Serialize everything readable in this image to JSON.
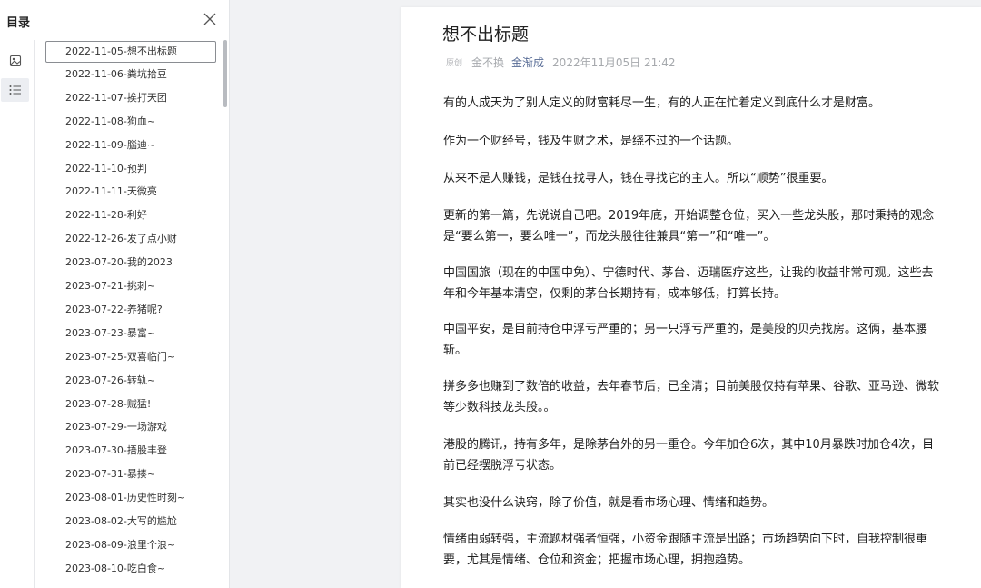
{
  "toc": {
    "title": "目录",
    "items": [
      "2022-11-05-想不出标题",
      "2022-11-06-粪坑拾豆",
      "2022-11-07-挨打天团",
      "2022-11-08-狗血~",
      "2022-11-09-腦迪~",
      "2022-11-10-预判",
      "2022-11-11-天微亮",
      "2022-11-28-利好",
      "2022-12-26-发了点小财",
      "2023-07-20-我的2023",
      "2023-07-21-挑刺~",
      "2023-07-22-养猪呢?",
      "2023-07-23-暴富~",
      "2023-07-25-双喜临门~",
      "2023-07-26-转轨~",
      "2023-07-28-贼猛!",
      "2023-07-29-一场游戏",
      "2023-07-30-捂股丰登",
      "2023-07-31-暴揍~",
      "2023-08-01-历史性时刻~",
      "2023-08-02-大写的尴尬",
      "2023-08-09-浪里个浪~",
      "2023-08-10-吃白食~"
    ],
    "active_index": 0
  },
  "article": {
    "title": "想不出标题",
    "original_tag": "原创",
    "account": "金不换",
    "author": "金渐成",
    "date": "2022年11月05日 21:42",
    "paragraphs": [
      "有的人成天为了别人定义的财富耗尽一生，有的人正在忙着定义到底什么才是财富。",
      "作为一个财经号，钱及生财之术，是绕不过的一个话题。",
      "从来不是人赚钱，是钱在找寻人，钱在寻找它的主人。所以“顺势”很重要。",
      "更新的第一篇，先说说自己吧。2019年底，开始调整仓位，买入一些龙头股，那时秉持的观念是“要么第一，要么唯一”，而龙头股往往兼具“第一”和“唯一”。",
      "中国国旅（现在的中国中免）、宁德时代、茅台、迈瑞医疗这些，让我的收益非常可观。这些去年和今年基本清空，仅剩的茅台长期持有，成本够低，打算长持。",
      "中国平安，是目前持仓中浮亏严重的；另一只浮亏严重的，是美股的贝壳找房。这俩，基本腰斩。",
      "拼多多也赚到了数倍的收益，去年春节后，已全清；目前美股仅持有苹果、谷歌、亚马逊、微软等少数科技龙头股。。",
      "港股的腾讯，持有多年，是除茅台外的另一重仓。今年加仓6次，其中10月暴跌时加仓4次，目前已经摆脱浮亏状态。",
      "其实也没什么诀窍，除了价值，就是看市场心理、情绪和趋势。",
      "情绪由弱转强，主流题材强者恒强，小资金跟随主流是出路；市场趋势向下时，自我控制很重要，尤其是情绪、仓位和资金；把握市场心理，拥抱趋势。"
    ]
  }
}
